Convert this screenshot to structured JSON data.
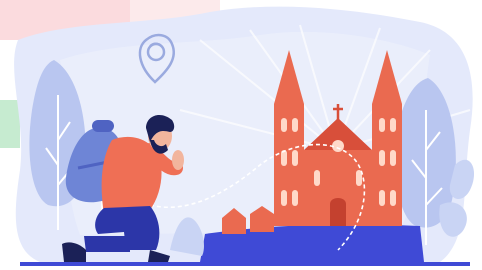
{
  "illustration": {
    "subject": "pilgrim-praying-before-cathedral",
    "icons": [
      "location-pin-icon",
      "church-icon",
      "cross-icon"
    ]
  },
  "colors": {
    "blob": "#e4e9fb",
    "blob_light": "#eef1fc",
    "ground": "#3f4ad6",
    "church_red": "#ea6a50",
    "church_dark": "#d84f3a",
    "window": "#ffd9c9",
    "tree_blue": "#b9c6f0",
    "tree_light": "#d3dcf7",
    "shirt": "#ef6f55",
    "pants": "#2c36a8",
    "backpack": "#6e85d6",
    "skin": "#f2b59d",
    "hair": "#1b2157",
    "pin": "#9aaadf",
    "pink_corner": "#f9cfd3",
    "green_corner": "#b8e6c4"
  }
}
